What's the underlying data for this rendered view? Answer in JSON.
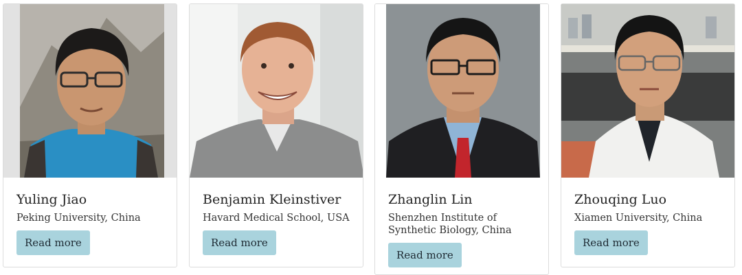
{
  "people": [
    {
      "name": "Yuling Jiao",
      "affiliation": "Peking University, China",
      "button": "Read more"
    },
    {
      "name": "Benjamin Kleinstiver",
      "affiliation": "Havard Medical School, USA",
      "button": "Read more"
    },
    {
      "name": "Zhanglin Lin",
      "affiliation": "Shenzhen Institute of Synthetic Biology, China",
      "button": "Read more"
    },
    {
      "name": "Zhouqing Luo",
      "affiliation": "Xiamen University, China",
      "button": "Read more"
    }
  ],
  "colors": {
    "button_bg": "#a9d3dd",
    "card_border": "#dcdcdc"
  },
  "icons": [
    "portrait-photo"
  ]
}
